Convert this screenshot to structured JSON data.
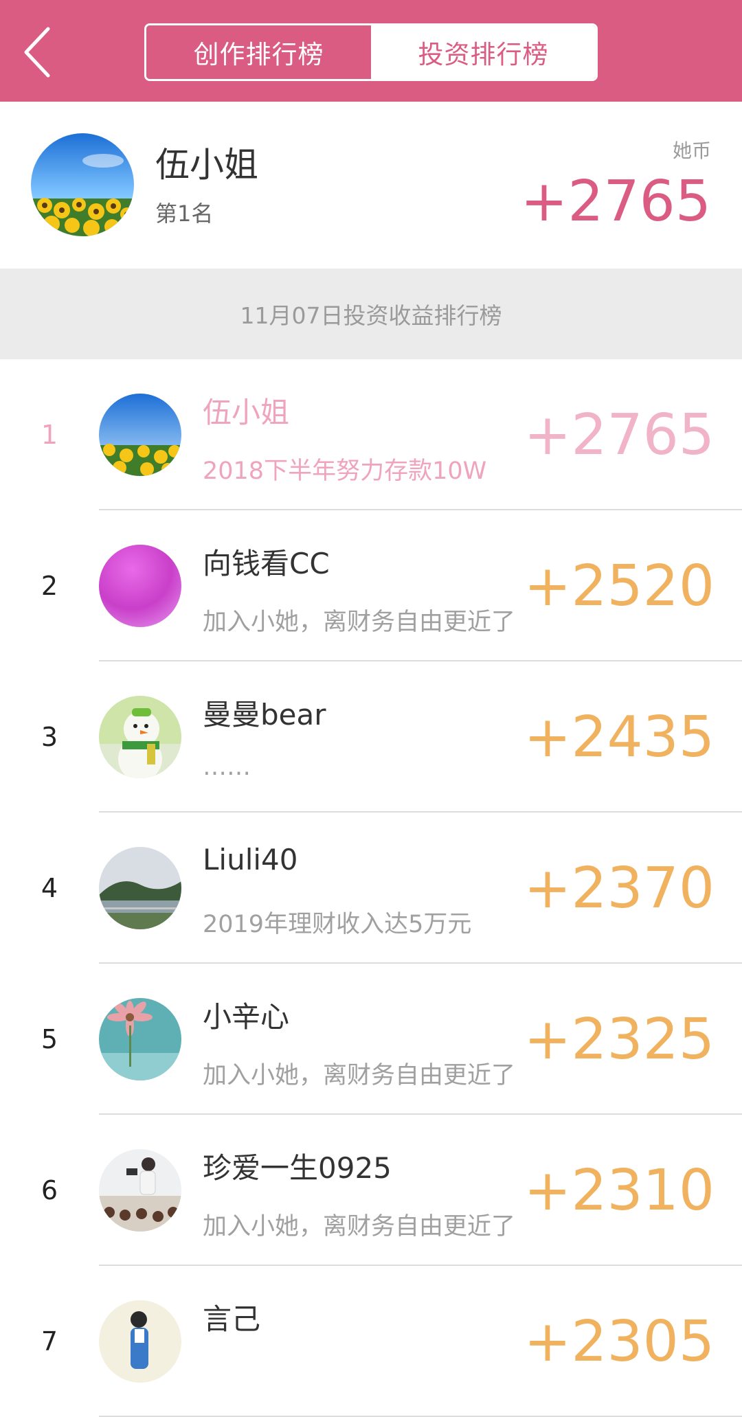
{
  "header": {
    "back_icon": "chevron-left-icon",
    "tabs": [
      {
        "label": "创作排行榜",
        "active": true
      },
      {
        "label": "投资排行榜",
        "active": false
      }
    ],
    "colors": {
      "accent": "#db5c82",
      "score_orange": "#f0b25f",
      "first_pink": "#f0a3bd"
    }
  },
  "top_user": {
    "name": "伍小姐",
    "rank_text": "第1名",
    "currency_label": "她币",
    "score": "+2765"
  },
  "section_title": "11月07日投资收益排行榜",
  "rows": [
    {
      "rank": "1",
      "name": "伍小姐",
      "motto": "2018下半年努力存款10W",
      "score": "+2765"
    },
    {
      "rank": "2",
      "name": "向钱看CC",
      "motto": "加入小她，离财务自由更近了",
      "score": "+2520"
    },
    {
      "rank": "3",
      "name": "曼曼bear",
      "motto": "……",
      "score": "+2435"
    },
    {
      "rank": "4",
      "name": "Liuli40",
      "motto": "2019年理财收入达5万元",
      "score": "+2370"
    },
    {
      "rank": "5",
      "name": "小辛心",
      "motto": "加入小她，离财务自由更近了",
      "score": "+2325"
    },
    {
      "rank": "6",
      "name": "珍爱一生0925",
      "motto": "加入小她，离财务自由更近了",
      "score": "+2310"
    },
    {
      "rank": "7",
      "name": "言己",
      "motto": "",
      "score": "+2305"
    }
  ]
}
